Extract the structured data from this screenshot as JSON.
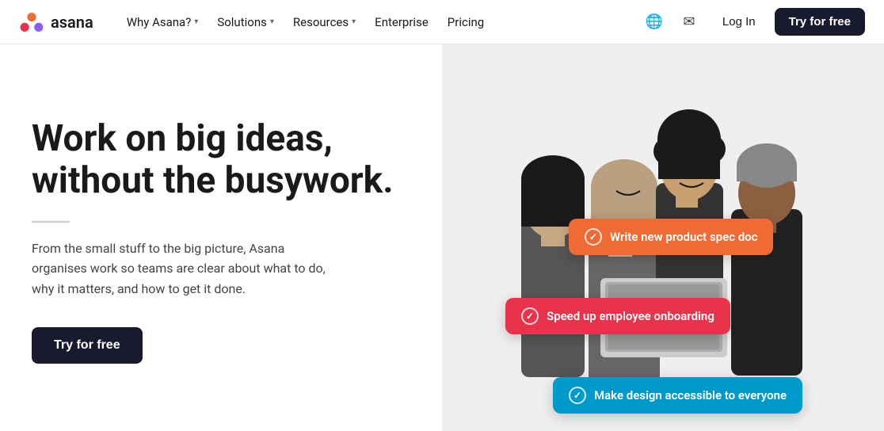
{
  "nav": {
    "logo_text": "asana",
    "links": [
      {
        "label": "Why Asana?",
        "has_dropdown": true
      },
      {
        "label": "Solutions",
        "has_dropdown": true
      },
      {
        "label": "Resources",
        "has_dropdown": true
      },
      {
        "label": "Enterprise",
        "has_dropdown": false
      },
      {
        "label": "Pricing",
        "has_dropdown": false
      }
    ],
    "globe_icon": "🌐",
    "mail_icon": "✉",
    "login_label": "Log In",
    "try_label": "Try for free"
  },
  "hero": {
    "title": "Work on big ideas, without the busywork.",
    "description": "From the small stuff to the big picture, Asana organises work so teams are clear about what to do, why it matters, and how to get it done.",
    "cta_label": "Try for free"
  },
  "badges": [
    {
      "label": "Write new product spec doc",
      "color": "orange",
      "class": "badge-orange"
    },
    {
      "label": "Speed up employee onboarding",
      "color": "red",
      "class": "badge-red"
    },
    {
      "label": "Make design accessible to everyone",
      "color": "blue",
      "class": "badge-blue"
    }
  ]
}
